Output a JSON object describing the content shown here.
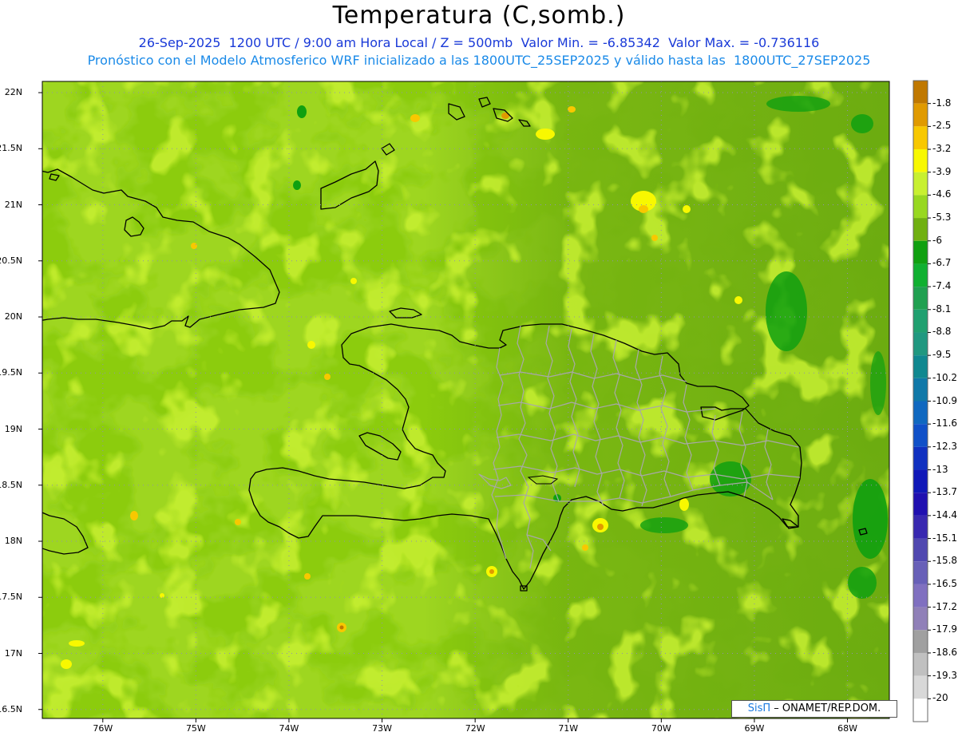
{
  "header": {
    "title": "Temperatura (C,somb.)",
    "subtitle_line1": "26-Sep-2025  1200 UTC / 9:00 am Hora Local / Z = 500mb  Valor Min. = -6.85342  Valor Max. = -0.736116",
    "subtitle_line2": "Pronóstico con el Modelo Atmosferico WRF inicializado a las 1800UTC_25SEP2025 y válido hasta las  1800UTC_27SEP2025"
  },
  "map": {
    "lat_labels": [
      "22N",
      "21.5N",
      "21N",
      "20.5N",
      "20N",
      "19.5N",
      "19N",
      "18.5N",
      "18N",
      "17.5N",
      "17N",
      "16.5N"
    ],
    "lon_labels": [
      "76W",
      "75W",
      "74W",
      "73W",
      "72W",
      "71W",
      "70W",
      "69W",
      "68W"
    ],
    "lat_values": [
      22,
      21.5,
      21,
      20.5,
      20,
      19.5,
      19,
      18.5,
      18,
      17.5,
      17,
      16.5
    ],
    "lon_values": [
      -76,
      -75,
      -74,
      -73,
      -72,
      -71,
      -70,
      -69,
      -68
    ],
    "lat_range": [
      16.42,
      22.1
    ],
    "lon_range": [
      -76.65,
      -67.55
    ]
  },
  "colorbar": {
    "levels": [
      "-1.8",
      "-2.5",
      "-3.2",
      "-3.9",
      "-4.6",
      "-5.3",
      "-6",
      "-6.7",
      "-7.4",
      "-8.1",
      "-8.8",
      "-9.5",
      "-10.2",
      "-10.9",
      "-11.6",
      "-12.3",
      "-13",
      "-13.7",
      "-14.4",
      "-15.1",
      "-15.8",
      "-16.5",
      "-17.2",
      "-17.9",
      "-18.6",
      "-19.3",
      "-20"
    ],
    "colors": [
      "#c07800",
      "#e09a00",
      "#f8c800",
      "#f8f800",
      "#c8f030",
      "#98d820",
      "#70b010",
      "#10a010",
      "#10b030",
      "#20a050",
      "#20a070",
      "#209880",
      "#108890",
      "#1078a8",
      "#1068c0",
      "#1050c8",
      "#1030c0",
      "#1018b8",
      "#2010b0",
      "#3828b0",
      "#5048b0",
      "#6860b8",
      "#8070c0",
      "#9080b8",
      "#a0a0a0",
      "#c0c0c0",
      "#d8d8d8",
      "#ffffff"
    ]
  },
  "credit": {
    "brand": "SisΠ",
    "text": " – ONAMET/REP.DOM."
  }
}
